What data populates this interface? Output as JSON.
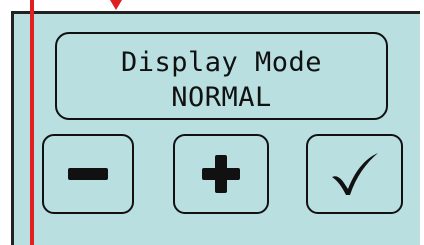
{
  "display": {
    "title": "Display Mode",
    "value": "NORMAL"
  },
  "buttons": {
    "decrease_icon": "minus-icon",
    "increase_icon": "plus-icon",
    "confirm_icon": "checkmark-icon"
  },
  "colors": {
    "screen_background": "#b9dfe1",
    "outline": "#111111",
    "marker": "#e02020"
  }
}
